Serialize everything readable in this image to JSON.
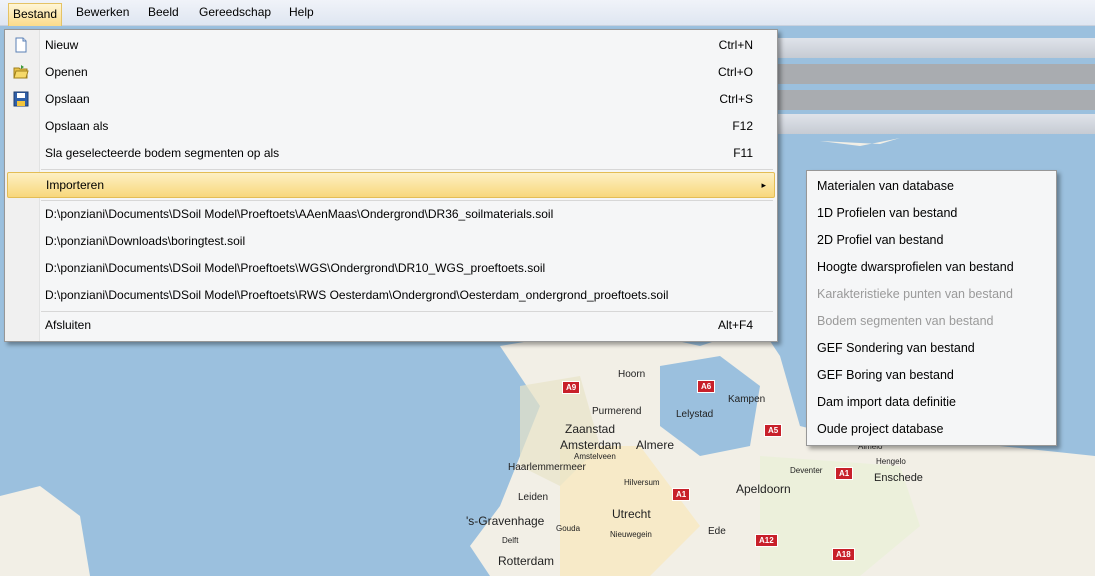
{
  "menubar": {
    "items": [
      {
        "label": "Bestand"
      },
      {
        "label": "Bewerken"
      },
      {
        "label": "Beeld"
      },
      {
        "label": "Gereedschap"
      },
      {
        "label": "Help"
      }
    ]
  },
  "file_menu": {
    "items": [
      {
        "label": "Nieuw",
        "shortcut": "Ctrl+N",
        "icon": "new-document-icon"
      },
      {
        "label": "Openen",
        "shortcut": "Ctrl+O",
        "icon": "open-folder-icon"
      },
      {
        "label": "Opslaan",
        "shortcut": "Ctrl+S",
        "icon": "save-disk-icon"
      },
      {
        "label": "Opslaan als",
        "shortcut": "F12"
      },
      {
        "label": "Sla geselecteerde bodem segmenten op als",
        "shortcut": "F11"
      },
      {
        "label": "Importeren",
        "shortcut": "▸"
      }
    ],
    "recent_files": [
      "D:\\ponziani\\Documents\\DSoil Model\\Proeftoets\\AAenMaas\\Ondergrond\\DR36_soilmaterials.soil",
      "D:\\ponziani\\Downloads\\boringtest.soil",
      "D:\\ponziani\\Documents\\DSoil Model\\Proeftoets\\WGS\\Ondergrond\\DR10_WGS_proeftoets.soil",
      "D:\\ponziani\\Documents\\DSoil Model\\Proeftoets\\RWS Oesterdam\\Ondergrond\\Oesterdam_ondergrond_proeftoets.soil"
    ],
    "exit": {
      "label": "Afsluiten",
      "shortcut": "Alt+F4"
    }
  },
  "import_submenu": {
    "items": [
      {
        "label": "Materialen van database",
        "enabled": true
      },
      {
        "label": "1D Profielen van bestand",
        "enabled": true
      },
      {
        "label": "2D Profiel van bestand",
        "enabled": true
      },
      {
        "label": "Hoogte dwarsprofielen van bestand",
        "enabled": true
      },
      {
        "label": "Karakteristieke punten van bestand",
        "enabled": false
      },
      {
        "label": "Bodem segmenten van bestand",
        "enabled": false
      },
      {
        "label": "GEF Sondering van bestand",
        "enabled": true
      },
      {
        "label": "GEF Boring van bestand",
        "enabled": true
      },
      {
        "label": "Dam import data definitie",
        "enabled": true
      },
      {
        "label": "Oude project database",
        "enabled": true
      }
    ]
  },
  "map": {
    "cities": [
      "Hoorn",
      "Purmerend",
      "Lelystad",
      "Kampen",
      "Zaanstad",
      "Amsterdam",
      "Almere",
      "Amstelveen",
      "Haarlemmermeer",
      "Hilversum",
      "Leiden",
      "Apeldoorn",
      "Deventer",
      "Almelo",
      "Hengelo",
      "Enschede",
      "Utrecht",
      "'s-Gravenhage",
      "Gouda",
      "Nieuwegein",
      "Ede",
      "Delft",
      "Rotterdam"
    ],
    "roads": [
      "A9",
      "A6",
      "A1",
      "A1",
      "A12",
      "A18",
      "A5"
    ]
  },
  "colors": {
    "water": "#9bc0de",
    "land": "#f2efe6",
    "highlight": "#f8d77b",
    "road": "#c8202a"
  }
}
